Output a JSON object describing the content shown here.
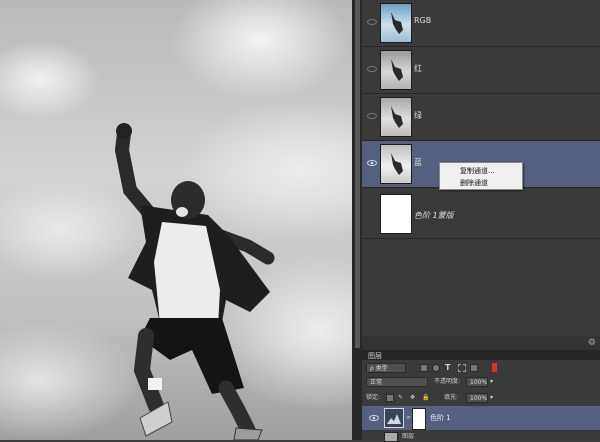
{
  "channels": [
    {
      "label": "RGB",
      "selected": false
    },
    {
      "label": "红",
      "selected": false
    },
    {
      "label": "绿",
      "selected": false
    },
    {
      "label": "蓝",
      "selected": true
    },
    {
      "label": "色阶 1蒙版",
      "selected": false
    }
  ],
  "context_menu": {
    "items": [
      "复制通道...",
      "删除通道"
    ]
  },
  "layers_panel": {
    "title": "图层",
    "filter_label": "ρ 类型",
    "blend_mode": "正常",
    "opacity_label": "不透明度:",
    "opacity_value": "100%",
    "lock_label": "锁定:",
    "fill_label": "填充:",
    "fill_value": "100%",
    "layer_name": "色阶 1",
    "layer2_name": "图层"
  }
}
